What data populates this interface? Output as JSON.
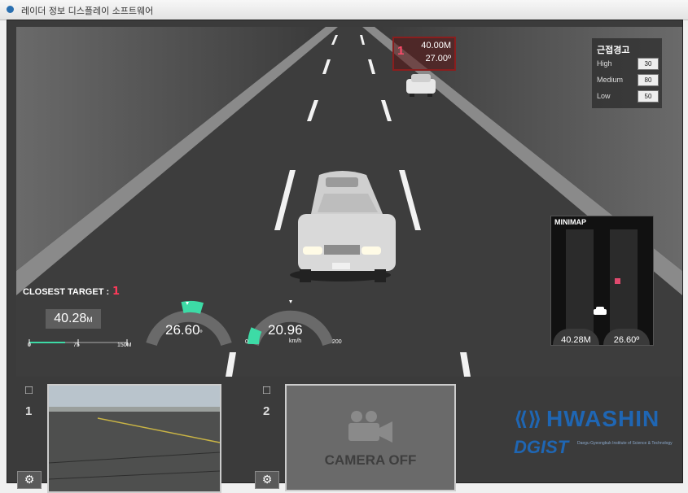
{
  "window": {
    "title": "레이더 정보 디스플레이 소프트웨어"
  },
  "target": {
    "id": "1",
    "distance": "40.00M",
    "angle": "27.00º"
  },
  "warning": {
    "title": "근접경고",
    "rows": [
      {
        "label": "High",
        "value": "30"
      },
      {
        "label": "Medium",
        "value": "80"
      },
      {
        "label": "Low",
        "value": "50"
      }
    ]
  },
  "closest": {
    "label": "CLOSEST TARGET :",
    "id": "1",
    "distance": "40.28",
    "distance_unit": "M",
    "scale_ticks": [
      "0",
      "75",
      "150M"
    ]
  },
  "angle_gauge": {
    "value": "26.60",
    "unit": "º"
  },
  "speed_gauge": {
    "value": "20.96",
    "unit": "km/h",
    "min": "0",
    "max": "200"
  },
  "minimap": {
    "title": "MINIMAP",
    "distance": "40.28M",
    "angle": "26.60º"
  },
  "cameras": [
    {
      "number": "1",
      "status": "on"
    },
    {
      "number": "2",
      "status": "CAMERA OFF"
    }
  ],
  "logos": {
    "brand": "HWASHIN",
    "partner": "DGIST",
    "partner_sub": "Daegu Gyeongbuk Institute of Science & Technology"
  },
  "colors": {
    "accent": "#1f66b3",
    "target": "#ff3a5a",
    "gauge": "#3ddba6"
  }
}
